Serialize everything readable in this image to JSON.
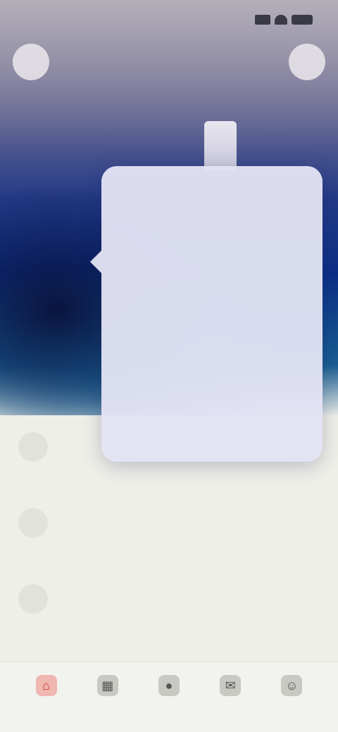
{
  "status_bar": {
    "time": "",
    "icons": [
      "signal-icon",
      "wifi-icon",
      "battery-icon"
    ]
  },
  "top_bar": {
    "back_icon": "avatar-icon",
    "title": "",
    "more_icon": "more-icon"
  },
  "popup_menu": {
    "items": [
      {
        "label": ""
      },
      {
        "label": ""
      },
      {
        "label": ""
      },
      {
        "label": ""
      },
      {
        "label": ""
      },
      {
        "label": ""
      },
      {
        "label": ""
      },
      {
        "label": ""
      }
    ]
  },
  "list": {
    "rows": [
      {
        "title": "",
        "subtitle": "",
        "meta": ""
      },
      {
        "title": "",
        "subtitle": "",
        "meta": ""
      },
      {
        "title": "",
        "subtitle": "",
        "meta": ""
      }
    ]
  },
  "tab_bar": {
    "tabs": [
      {
        "label": "",
        "icon": "home-icon",
        "active": true
      },
      {
        "label": "",
        "icon": "grid-icon",
        "active": false
      },
      {
        "label": "",
        "icon": "center-icon",
        "active": false
      },
      {
        "label": "",
        "icon": "message-icon",
        "active": false
      },
      {
        "label": "",
        "icon": "profile-icon",
        "active": false
      }
    ]
  },
  "colors": {
    "accent": "#c0392b",
    "hero_top": "#a9a6b3",
    "hero_mid": "#0c2f86",
    "menu_bg": "#e2e2f4",
    "page_bg": "#efefe9"
  }
}
